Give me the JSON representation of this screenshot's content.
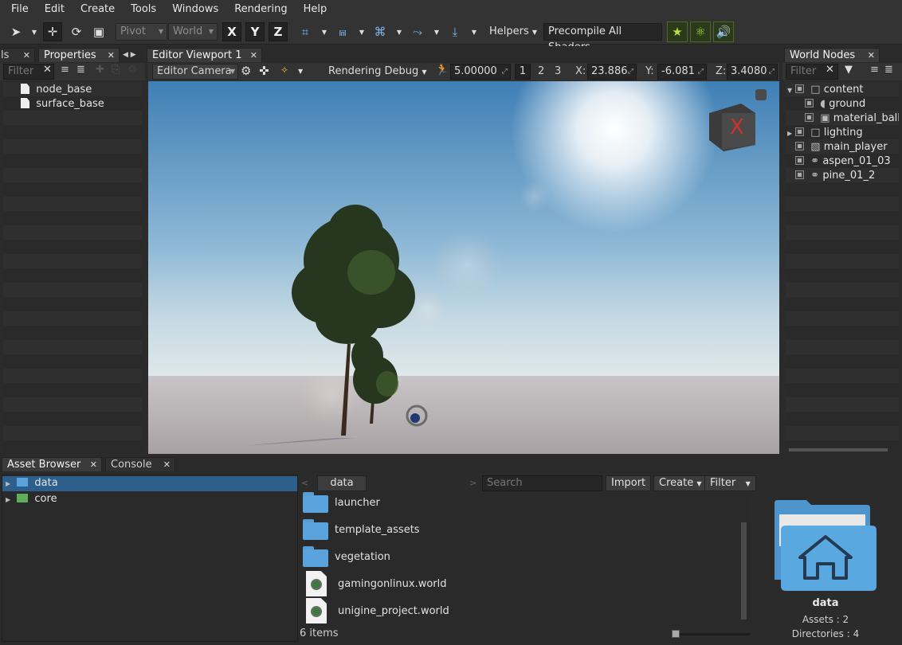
{
  "menu": [
    "File",
    "Edit",
    "Create",
    "Tools",
    "Windows",
    "Rendering",
    "Help"
  ],
  "toolbar": {
    "pivot": "Pivot",
    "world": "World",
    "axes": [
      "X",
      "Y",
      "Z"
    ],
    "helpers": "Helpers",
    "precompile": "Precompile All Shaders"
  },
  "left_panel": {
    "partial_tab": "ls",
    "tab": "Properties",
    "filter_placeholder": "Filter",
    "items": [
      "node_base",
      "surface_base"
    ]
  },
  "viewport": {
    "tab": "Editor Viewport 1",
    "camera": "Editor Camera",
    "render_mode": "Rendering Debug",
    "speed": "5.00000",
    "layouts": [
      "1",
      "2",
      "3"
    ],
    "x_label": "X:",
    "x_value": "23.886",
    "y_label": "Y:",
    "y_value": "-6.081",
    "z_label": "Z:",
    "z_value": "3.4080",
    "gizmo_axis": "X"
  },
  "world_nodes": {
    "tab": "World Nodes",
    "filter_placeholder": "Filter",
    "items": [
      {
        "label": "content"
      },
      {
        "label": "ground"
      },
      {
        "label": "material_ball"
      },
      {
        "label": "lighting"
      },
      {
        "label": "main_player"
      },
      {
        "label": "aspen_01_03"
      },
      {
        "label": "pine_01_2"
      }
    ]
  },
  "bottom_tabs": [
    "Asset Browser",
    "Console"
  ],
  "asset_tree": [
    "data",
    "core"
  ],
  "asset_browser": {
    "path": "data",
    "search_placeholder": "Search",
    "import": "Import",
    "create": "Create",
    "filter": "Filter",
    "items": [
      {
        "name": "launcher",
        "type": "folder"
      },
      {
        "name": "template_assets",
        "type": "folder"
      },
      {
        "name": "vegetation",
        "type": "folder"
      },
      {
        "name": "gamingonlinux.world",
        "type": "world"
      },
      {
        "name": "unigine_project.world",
        "type": "world"
      }
    ],
    "count": "6 items"
  },
  "preview": {
    "name": "data",
    "assets": "Assets : 2",
    "directories": "Directories : 4"
  },
  "colors": {
    "accent": "#2d5f8c",
    "folder": "#5aa3dc",
    "bg": "#2b2b2b"
  }
}
